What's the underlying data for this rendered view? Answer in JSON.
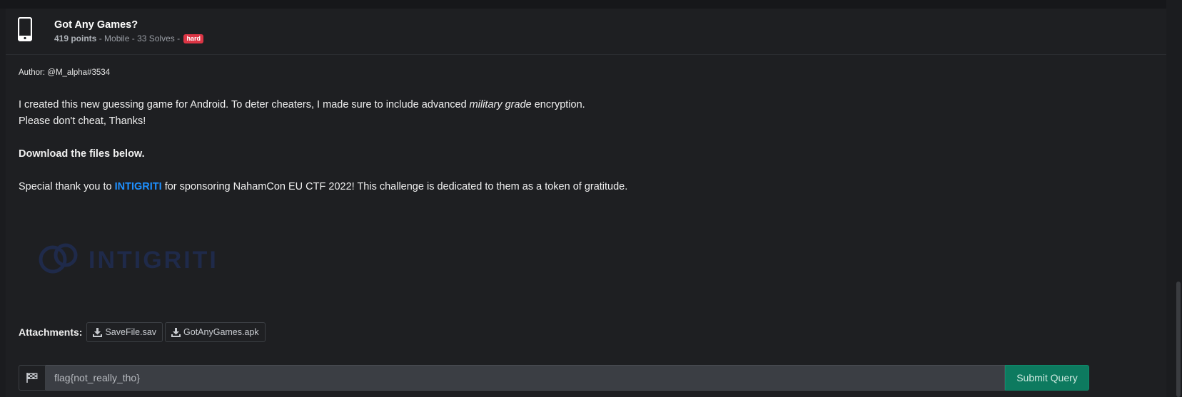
{
  "challenge": {
    "title": "Got Any Games?",
    "points": "419 points",
    "sep1": " - ",
    "category": "Mobile",
    "sep2": " - ",
    "solves": "33 Solves",
    "sep3": " - ",
    "difficulty": "hard",
    "icon": "mobile-phone-icon"
  },
  "description": {
    "author": "Author: @M_alpha#3534",
    "line1_before": "I created this new guessing game for Android. To deter cheaters, I made sure to include advanced ",
    "line1_em": "military grade",
    "line1_after": " encryption.",
    "line2": "Please don't cheat, Thanks!",
    "download": "Download the files below.",
    "thanks_before": "Special thank you to ",
    "thanks_link": "INTIGRITI",
    "thanks_after": " for sponsoring NahamCon EU CTF 2022! This challenge is dedicated to them as a token of gratitude.",
    "logo_text": "INTIGRITI"
  },
  "attachments": {
    "label": "Attachments:",
    "files": [
      {
        "name": "SaveFile.sav",
        "icon": "download-icon"
      },
      {
        "name": "GotAnyGames.apk",
        "icon": "download-icon"
      }
    ]
  },
  "flag_form": {
    "icon": "flag-icon",
    "value": "flag{not_really_tho}",
    "submit_label": "Submit Query"
  },
  "colors": {
    "background": "#1e1f22",
    "badge": "#dc3545",
    "link": "#1e90ff",
    "submit": "#0d7a5f"
  }
}
